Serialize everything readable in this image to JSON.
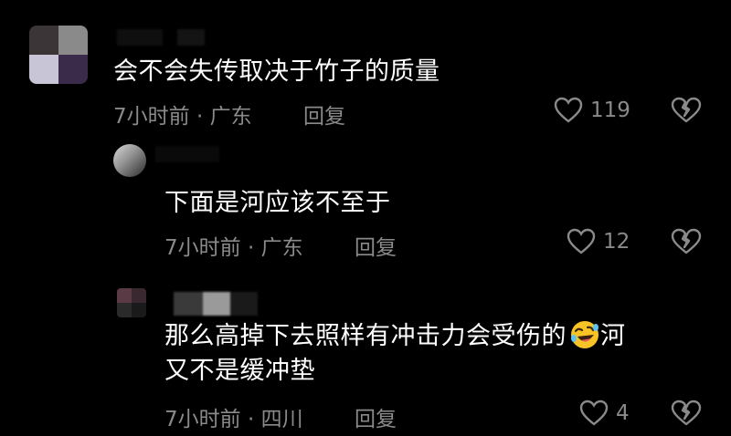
{
  "comments": [
    {
      "text": "会不会失传取决于竹子的质量",
      "meta": "7小时前 · 广东",
      "reply_label": "回复",
      "likes": "119",
      "avatar_colors": [
        "#3b3538",
        "#8a8a8a",
        "#c7c5d6",
        "#3a2b4a"
      ]
    },
    {
      "text": "下面是河应该不至于",
      "meta": "7小时前 · 广东",
      "reply_label": "回复",
      "likes": "12",
      "avatar_colors": [
        "#cfcfcf",
        "#5a5a5a",
        "#3a3a3a",
        "#1a1a1a"
      ]
    },
    {
      "text_line1": "那么高掉下去照样有冲击力会受伤的",
      "text_line1_tail": "河",
      "text_line2": "又不是缓冲垫",
      "emoji": "rolling-on-floor-laughing",
      "meta": "7小时前 · 四川",
      "reply_label": "回复",
      "likes": "4",
      "avatar_colors": [
        "#5a3a45",
        "#3a2830",
        "#2a2a2a",
        "#1a1a1a"
      ]
    }
  ],
  "colors": {
    "background": "#000000",
    "text": "#ffffff",
    "secondary": "#8a8a8a"
  }
}
